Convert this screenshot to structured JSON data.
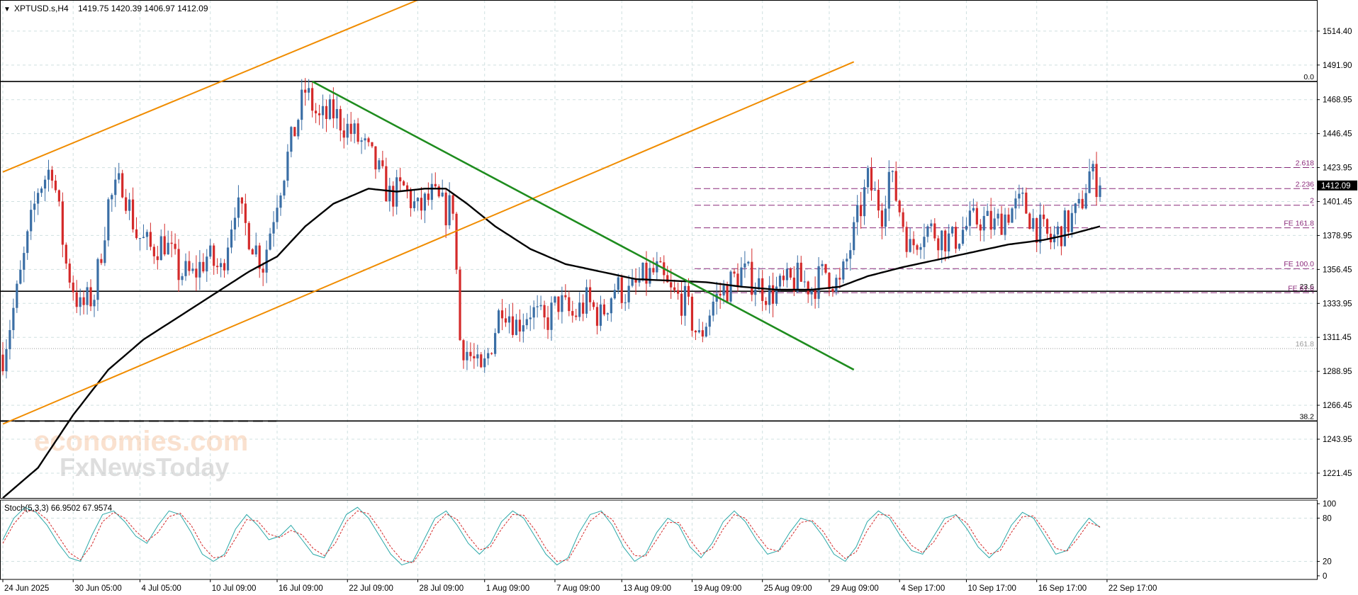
{
  "header": {
    "symbol": "XPTUSD.s,H4",
    "ohlc": "1419.75 1420.39 1406.97 1412.09"
  },
  "indicator": {
    "label": "Stoch(5,3,3) 66.9502 67.9574"
  },
  "watermark": {
    "line1": "economies.com",
    "line2": "FxNewsToday"
  },
  "colors": {
    "bull_candle": "#3a6ea5",
    "bear_candle": "#d42a2a",
    "moving_average": "#000000",
    "channel": "#f08c00",
    "trendline": "#1e8c1e",
    "fibo": "#8a2a7a",
    "stoch_main": "#2aa8a8",
    "stoch_signal": "#d42a2a"
  },
  "chart_data": [
    {
      "type": "candlestick",
      "symbol": "XPTUSD.s",
      "timeframe": "H4",
      "title": "XPTUSD.s,H4",
      "current_price": 1412.09,
      "ylim": [
        1205,
        1535
      ],
      "y_ticks": [
        1221.45,
        1243.95,
        1266.45,
        1288.95,
        1311.45,
        1333.95,
        1356.45,
        1378.95,
        1401.45,
        1423.95,
        1446.45,
        1468.95,
        1491.9,
        1514.4
      ],
      "x_ticks": [
        "24 Jun 2025",
        "30 Jun 05:00",
        "4 Jul 05:00",
        "10 Jul 09:00",
        "16 Jul 09:00",
        "22 Jul 09:00",
        "28 Jul 09:00",
        "1 Aug 09:00",
        "7 Aug 09:00",
        "13 Aug 09:00",
        "19 Aug 09:00",
        "25 Aug 09:00",
        "29 Aug 09:00",
        "4 Sep 17:00",
        "10 Sep 17:00",
        "16 Sep 17:00",
        "22 Sep 17:00"
      ],
      "price_path": [
        [
          0,
          1300
        ],
        [
          4,
          1340
        ],
        [
          10,
          1410
        ],
        [
          14,
          1425
        ],
        [
          18,
          1360
        ],
        [
          22,
          1330
        ],
        [
          26,
          1340
        ],
        [
          30,
          1400
        ],
        [
          34,
          1415
        ],
        [
          38,
          1380
        ],
        [
          42,
          1370
        ],
        [
          46,
          1375
        ],
        [
          50,
          1355
        ],
        [
          54,
          1352
        ],
        [
          58,
          1365
        ],
        [
          62,
          1355
        ],
        [
          66,
          1400
        ],
        [
          70,
          1380
        ],
        [
          74,
          1360
        ],
        [
          78,
          1405
        ],
        [
          82,
          1440
        ],
        [
          86,
          1475
        ],
        [
          90,
          1455
        ],
        [
          94,
          1460
        ],
        [
          98,
          1450
        ],
        [
          102,
          1440
        ],
        [
          106,
          1425
        ],
        [
          110,
          1405
        ],
        [
          114,
          1410
        ],
        [
          118,
          1395
        ],
        [
          122,
          1405
        ],
        [
          126,
          1395
        ],
        [
          128,
          1400
        ],
        [
          130,
          1310
        ],
        [
          134,
          1295
        ],
        [
          136,
          1285
        ],
        [
          138,
          1300
        ],
        [
          142,
          1335
        ],
        [
          146,
          1320
        ],
        [
          150,
          1330
        ],
        [
          154,
          1320
        ],
        [
          158,
          1335
        ],
        [
          162,
          1325
        ],
        [
          166,
          1335
        ],
        [
          170,
          1325
        ],
        [
          174,
          1345
        ],
        [
          178,
          1340
        ],
        [
          182,
          1350
        ],
        [
          186,
          1355
        ],
        [
          190,
          1340
        ],
        [
          194,
          1335
        ],
        [
          198,
          1310
        ],
        [
          202,
          1335
        ],
        [
          206,
          1345
        ],
        [
          210,
          1355
        ],
        [
          214,
          1348
        ],
        [
          218,
          1340
        ],
        [
          222,
          1345
        ],
        [
          226,
          1350
        ],
        [
          230,
          1345
        ],
        [
          234,
          1355
        ],
        [
          238,
          1345
        ],
        [
          242,
          1380
        ],
        [
          246,
          1415
        ],
        [
          250,
          1395
        ],
        [
          252,
          1420
        ],
        [
          254,
          1405
        ],
        [
          258,
          1370
        ],
        [
          262,
          1385
        ],
        [
          266,
          1380
        ],
        [
          270,
          1375
        ],
        [
          274,
          1385
        ],
        [
          278,
          1390
        ],
        [
          282,
          1385
        ],
        [
          286,
          1395
        ],
        [
          290,
          1400
        ],
        [
          294,
          1385
        ],
        [
          298,
          1375
        ],
        [
          302,
          1385
        ],
        [
          306,
          1395
        ],
        [
          309,
          1420
        ],
        [
          312,
          1412.09
        ]
      ],
      "moving_average": [
        [
          0,
          1205
        ],
        [
          10,
          1225
        ],
        [
          20,
          1260
        ],
        [
          30,
          1290
        ],
        [
          40,
          1310
        ],
        [
          50,
          1325
        ],
        [
          60,
          1340
        ],
        [
          70,
          1355
        ],
        [
          78,
          1365
        ],
        [
          86,
          1385
        ],
        [
          94,
          1400
        ],
        [
          104,
          1410
        ],
        [
          112,
          1408
        ],
        [
          120,
          1410
        ],
        [
          126,
          1410
        ],
        [
          132,
          1400
        ],
        [
          140,
          1385
        ],
        [
          150,
          1370
        ],
        [
          160,
          1360
        ],
        [
          170,
          1355
        ],
        [
          180,
          1350
        ],
        [
          190,
          1349
        ],
        [
          200,
          1348
        ],
        [
          210,
          1345
        ],
        [
          220,
          1343
        ],
        [
          230,
          1343
        ],
        [
          238,
          1345
        ],
        [
          246,
          1352
        ],
        [
          256,
          1358
        ],
        [
          266,
          1363
        ],
        [
          276,
          1368
        ],
        [
          286,
          1373
        ],
        [
          296,
          1376
        ],
        [
          304,
          1380
        ],
        [
          312,
          1385
        ]
      ],
      "channel_lines": [
        {
          "from": [
            0,
            1421
          ],
          "to": [
            118,
            1535
          ]
        },
        {
          "from": [
            0,
            1254
          ],
          "to": [
            242,
            1494
          ]
        }
      ],
      "trendline": {
        "from": [
          88,
          1481
        ],
        "to": [
          242,
          1290
        ]
      },
      "horizontal_levels": [
        {
          "price": 1481,
          "label": "0.0"
        },
        {
          "price": 1342,
          "label": "23.6"
        },
        {
          "price": 1256,
          "label": "38.2"
        },
        {
          "price": 1304,
          "label": "161.8",
          "dotted": true
        }
      ],
      "fibo_expansion": [
        {
          "price": 1424,
          "label": "2.618"
        },
        {
          "price": 1410,
          "label": "2.236"
        },
        {
          "price": 1399,
          "label": "2"
        },
        {
          "price": 1384,
          "label": "FE 161.8"
        },
        {
          "price": 1357,
          "label": "FE 100.0"
        },
        {
          "price": 1341,
          "label": "FE 61.8"
        }
      ]
    },
    {
      "type": "line",
      "title": "Stoch(5,3,3) 66.9502 67.9574",
      "ylim": [
        -5,
        105
      ],
      "y_ticks": [
        0,
        20,
        80,
        100
      ],
      "series": [
        {
          "values": [
            50,
            80,
            95,
            88,
            70,
            45,
            25,
            20,
            55,
            85,
            90,
            75,
            55,
            45,
            70,
            90,
            85,
            60,
            30,
            20,
            30,
            65,
            85,
            70,
            50,
            55,
            70,
            50,
            30,
            25,
            55,
            85,
            95,
            80,
            55,
            30,
            15,
            20,
            50,
            80,
            90,
            70,
            45,
            30,
            45,
            75,
            90,
            80,
            55,
            30,
            15,
            25,
            60,
            85,
            90,
            70,
            40,
            20,
            30,
            60,
            80,
            70,
            40,
            25,
            45,
            75,
            90,
            75,
            50,
            30,
            35,
            60,
            80,
            75,
            55,
            30,
            20,
            40,
            75,
            90,
            80,
            55,
            35,
            30,
            55,
            80,
            85,
            65,
            40,
            25,
            40,
            70,
            88,
            80,
            55,
            30,
            35,
            60,
            80,
            67
          ]
        },
        {
          "values": [
            45,
            72,
            90,
            90,
            78,
            55,
            32,
            22,
            42,
            75,
            88,
            80,
            62,
            48,
            60,
            82,
            87,
            70,
            42,
            25,
            27,
            52,
            78,
            76,
            58,
            53,
            63,
            57,
            38,
            28,
            45,
            75,
            90,
            86,
            65,
            40,
            22,
            18,
            40,
            70,
            86,
            78,
            55,
            36,
            40,
            65,
            85,
            84,
            64,
            38,
            20,
            22,
            48,
            76,
            88,
            78,
            50,
            28,
            27,
            50,
            74,
            74,
            50,
            30,
            38,
            65,
            85,
            80,
            58,
            38,
            34,
            52,
            74,
            77,
            62,
            38,
            24,
            33,
            63,
            85,
            84,
            63,
            42,
            32,
            47,
            72,
            84,
            73,
            48,
            30,
            35,
            60,
            82,
            83,
            63,
            38,
            34,
            52,
            74,
            68
          ]
        }
      ]
    }
  ]
}
